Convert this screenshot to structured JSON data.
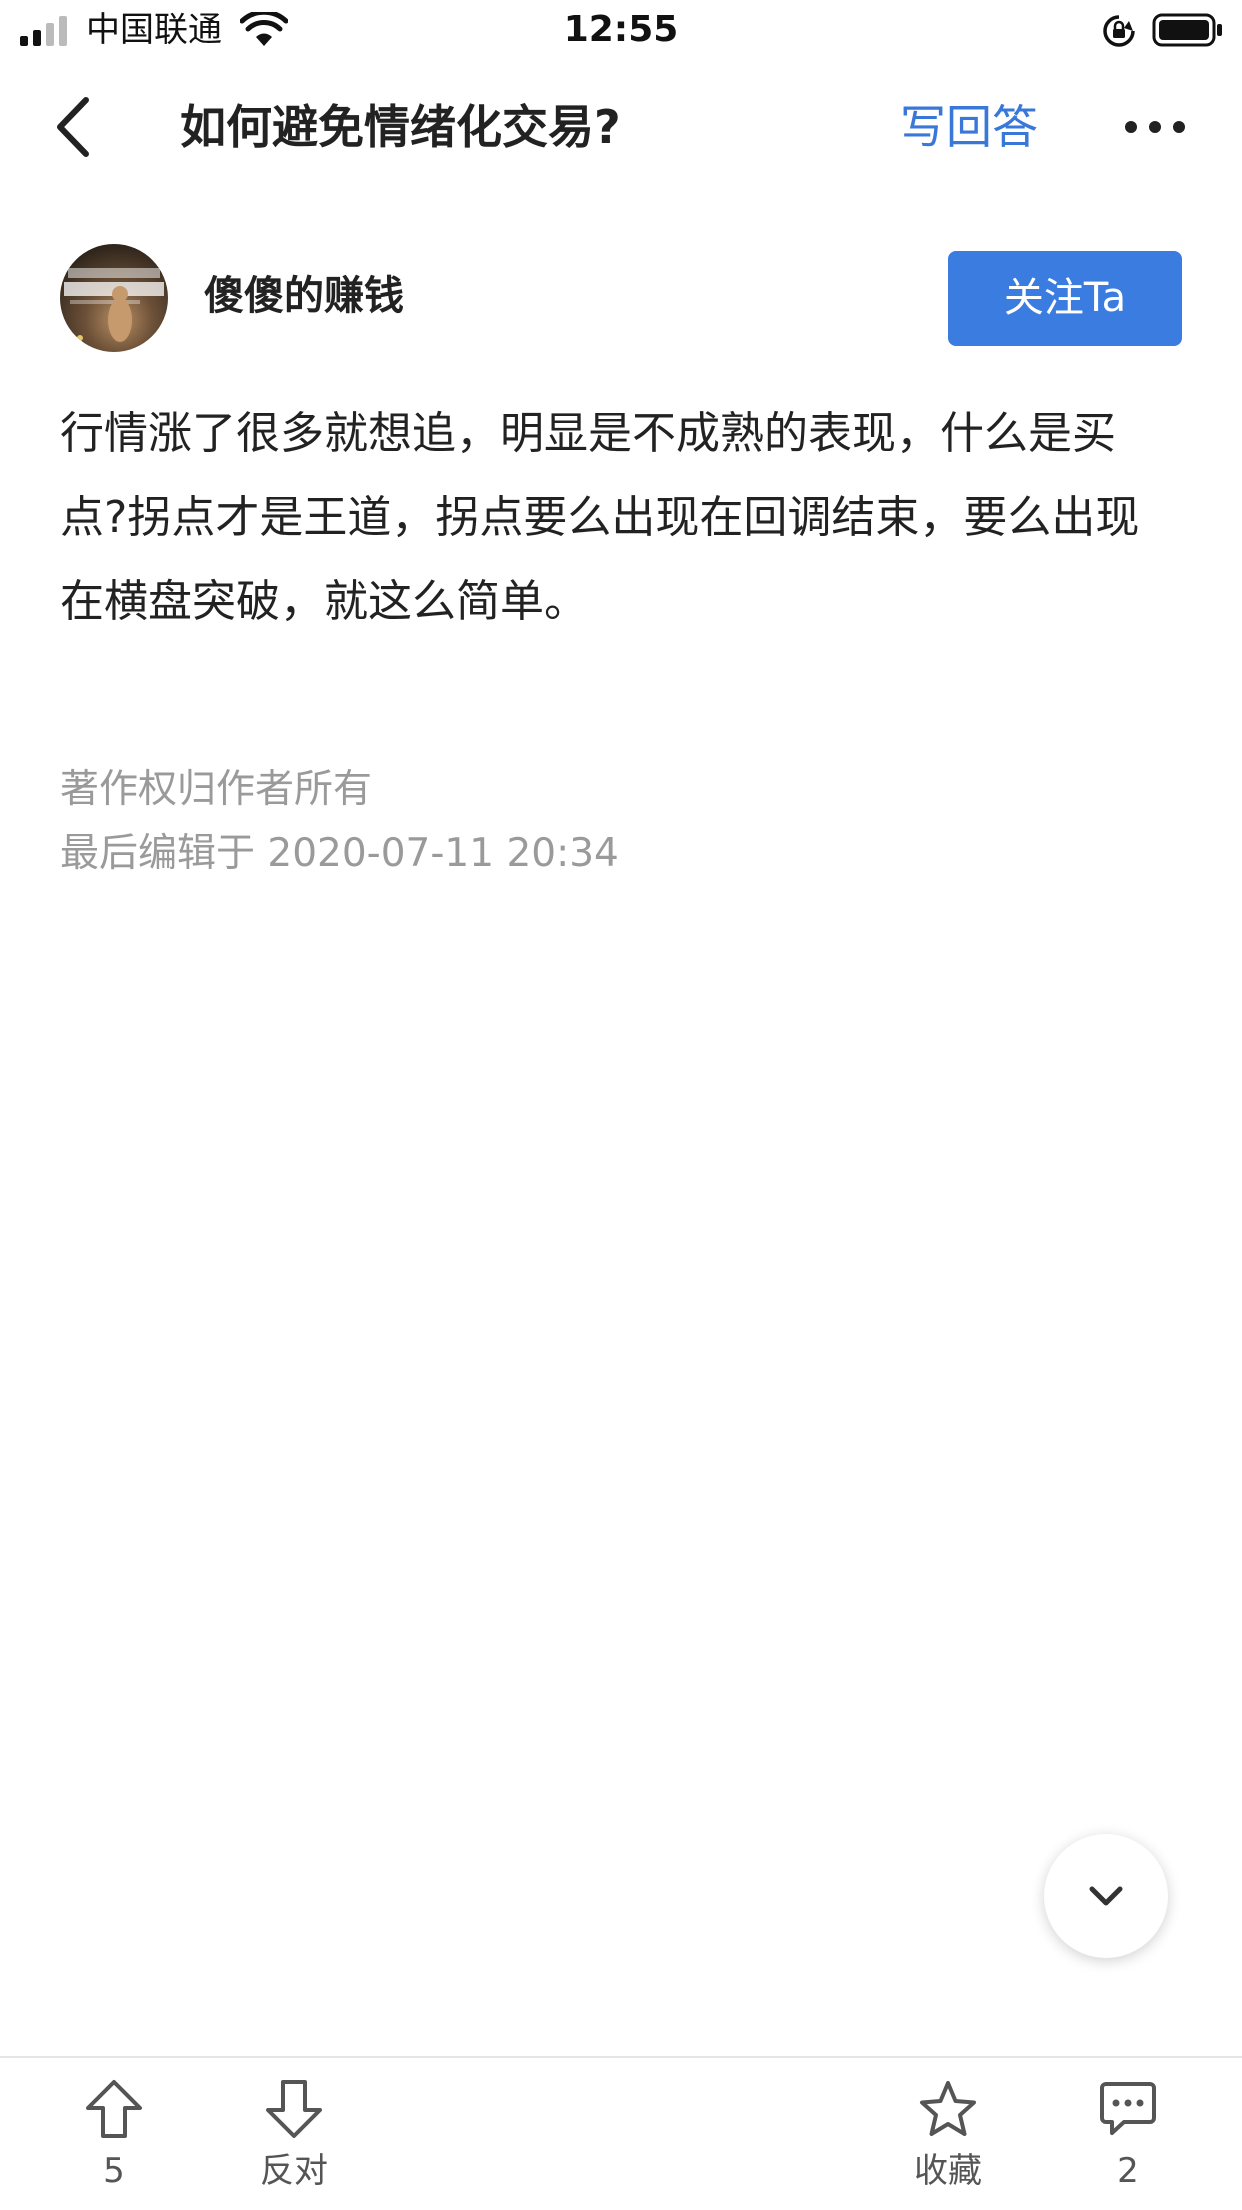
{
  "status_bar": {
    "carrier": "中国联通",
    "time": "12:55"
  },
  "nav": {
    "title": "如何避免情绪化交易?",
    "write_answer": "写回答"
  },
  "author": {
    "name": "傻傻的赚钱",
    "follow_label": "关注Ta"
  },
  "answer": {
    "text": "行情涨了很多就想追，明显是不成熟的表现，什么是买点?拐点才是王道，拐点要么出现在回调结束，要么出现在横盘突破，就这么简单。",
    "copyright": "著作权归作者所有",
    "edited": "最后编辑于 2020-07-11 20:34"
  },
  "toolbar": {
    "upvote_count": "5",
    "downvote_label": "反对",
    "favorite_label": "收藏",
    "comment_count": "2"
  },
  "colors": {
    "accent": "#3a7ce0",
    "link": "#3a78d8",
    "muted_text": "#9a9a9a"
  },
  "icons": {
    "back": "chevron-left-icon",
    "more": "more-dots-icon",
    "scroll": "chevron-down-icon",
    "upvote": "arrow-up-icon",
    "downvote": "arrow-down-icon",
    "favorite": "star-icon",
    "comment": "comment-bubble-icon"
  }
}
